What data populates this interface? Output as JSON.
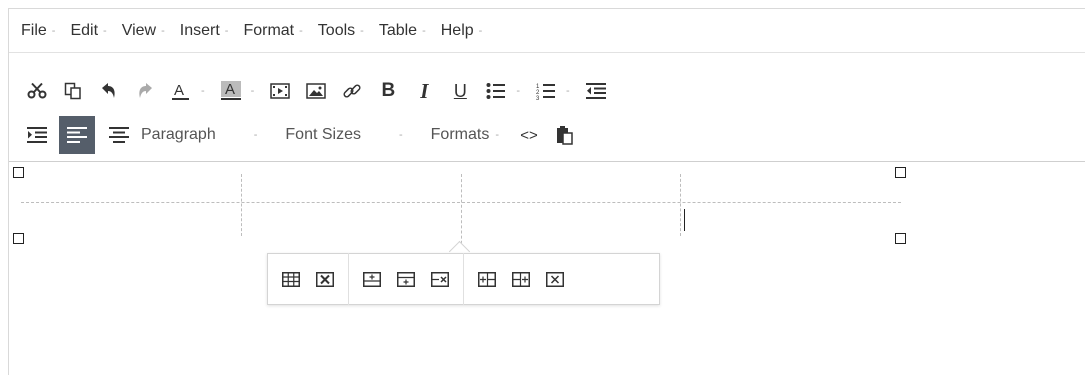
{
  "menubar": {
    "items": [
      {
        "label": "File"
      },
      {
        "label": "Edit"
      },
      {
        "label": "View"
      },
      {
        "label": "Insert"
      },
      {
        "label": "Format"
      },
      {
        "label": "Tools"
      },
      {
        "label": "Table"
      },
      {
        "label": "Help"
      }
    ],
    "caret": "-"
  },
  "toolbar1": {
    "buttons": [
      {
        "icon": "cut-icon"
      },
      {
        "icon": "copy-icon"
      },
      {
        "icon": "undo-icon"
      },
      {
        "icon": "redo-icon"
      },
      {
        "icon": "text-color-icon",
        "dropdown": true
      },
      {
        "icon": "background-color-icon",
        "dropdown": true
      },
      {
        "icon": "media-icon"
      },
      {
        "icon": "image-icon"
      },
      {
        "icon": "link-icon"
      },
      {
        "icon": "bold-icon"
      },
      {
        "icon": "italic-icon"
      },
      {
        "icon": "underline-icon"
      },
      {
        "icon": "bullet-list-icon",
        "dropdown": true
      },
      {
        "icon": "numbered-list-icon",
        "dropdown": true
      },
      {
        "icon": "outdent-icon"
      }
    ],
    "text_color_letter": "A",
    "bg_color_letter": "A",
    "bold_letter": "B",
    "italic_letter": "I",
    "underline_letter": "U"
  },
  "toolbar2": {
    "paragraph_label": "Paragraph",
    "font_sizes_label": "Font Sizes",
    "formats_label": "Formats",
    "code_label": "<>",
    "caret": "-",
    "active_button": "align-left-icon",
    "colors": {
      "active_bg": "#555e6a"
    }
  },
  "table_popup": {
    "groups": [
      [
        "table-properties-icon",
        "delete-table-icon"
      ],
      [
        "insert-row-before-icon",
        "insert-row-after-icon",
        "delete-row-icon"
      ],
      [
        "insert-column-before-icon",
        "insert-column-after-icon",
        "delete-column-icon"
      ]
    ]
  }
}
